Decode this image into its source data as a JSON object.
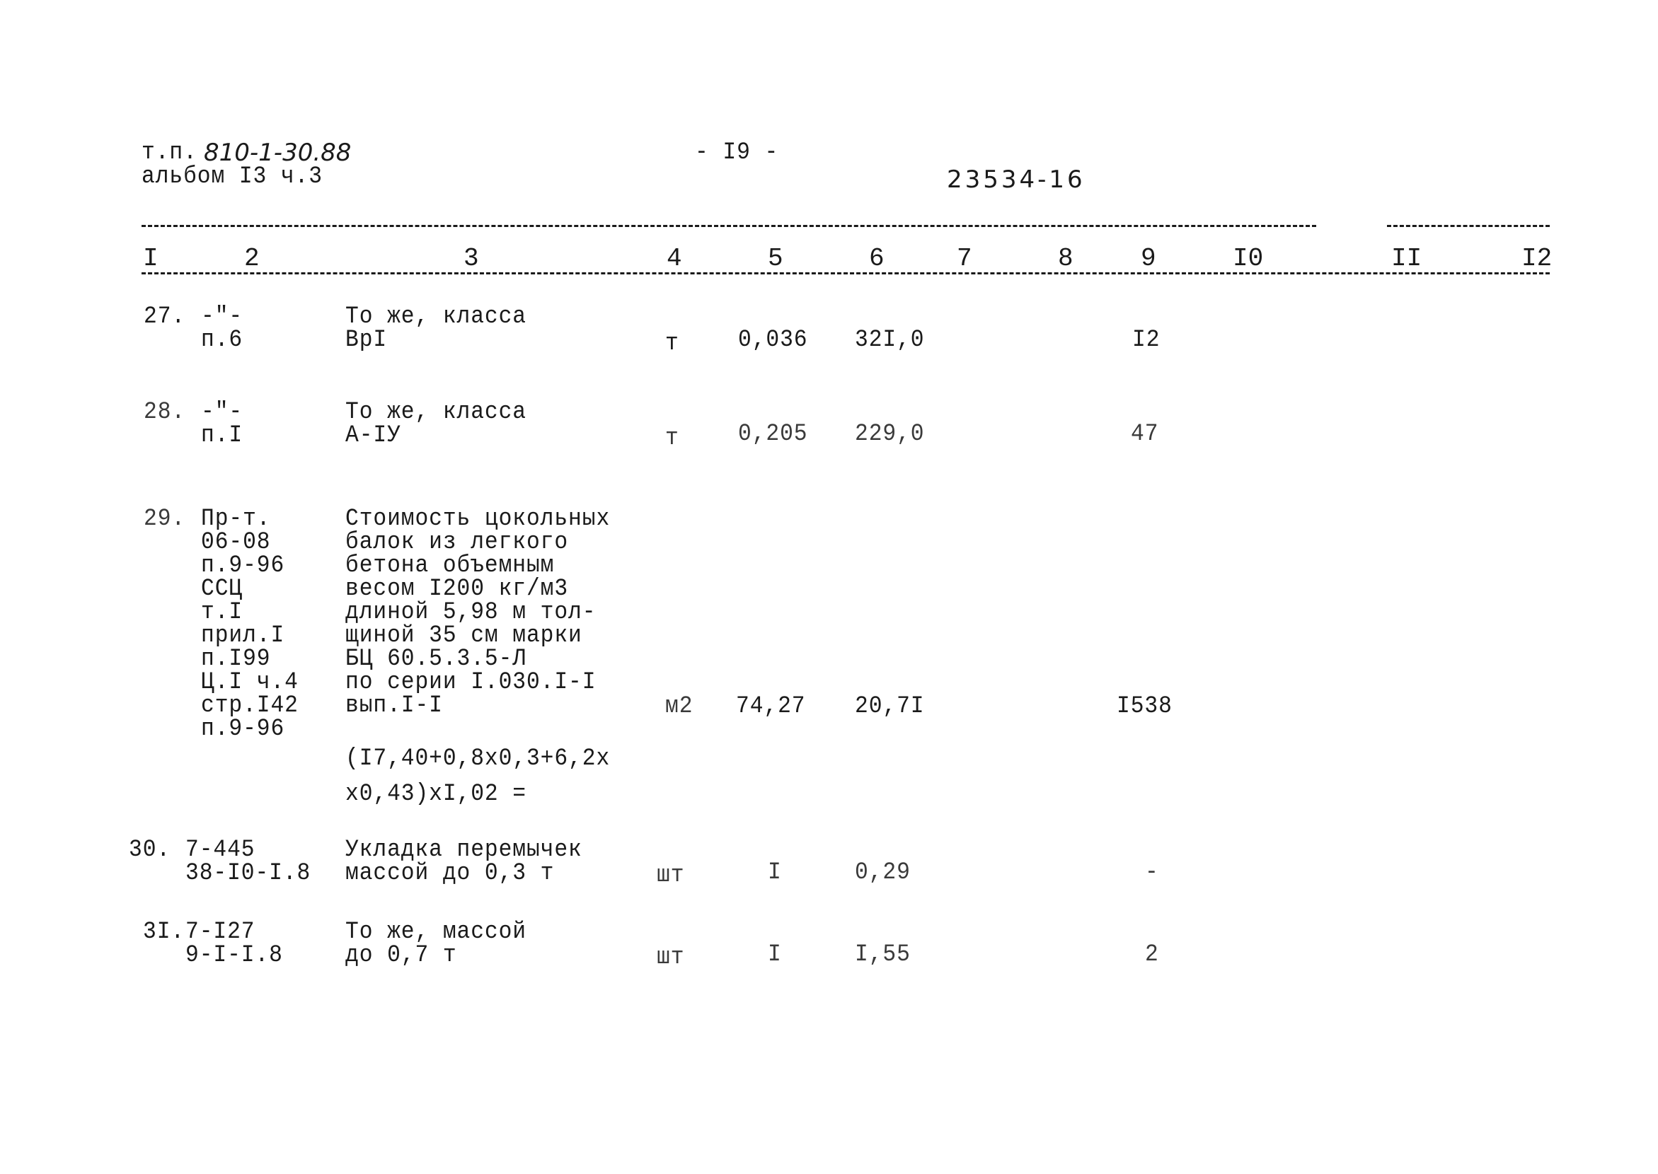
{
  "header": {
    "project_prefix": "т.п.",
    "project_code": "810-1-30.88",
    "album": "альбом I3 ч.3",
    "page_number": "- I9 -",
    "inventory_number": "23534-16"
  },
  "table": {
    "column_numbers": [
      "I",
      "2",
      "3",
      "4",
      "5",
      "6",
      "7",
      "8",
      "9",
      "I0",
      "II",
      "I2"
    ],
    "rows": [
      {
        "num": "27.",
        "ref": [
          "-\"-",
          "п.6"
        ],
        "description": [
          "То же, класса",
          "ВрI"
        ],
        "unit": "т",
        "quantity": "0,036",
        "unit_price": "32I,0",
        "total": "I2"
      },
      {
        "num": "28.",
        "ref": [
          "-\"-",
          "п.I"
        ],
        "description": [
          "То же, класса",
          "А-IУ"
        ],
        "unit": "т",
        "quantity": "0,205",
        "unit_price": "229,0",
        "total": "47"
      },
      {
        "num": "29.",
        "ref": [
          "Пр-т.",
          "06-08",
          "п.9-96",
          "ССЦ",
          "т.I",
          "прил.I",
          "п.I99",
          "Ц.I ч.4",
          "стр.I42",
          "п.9-96"
        ],
        "description": [
          "Стоимость цокольных",
          "балок из легкого",
          "бетона объемным",
          "весом I200 кг/м3",
          "длиной 5,98 м тол-",
          "щиной 35 см марки",
          "БЦ 60.5.3.5-Л",
          "по серии I.030.I-I",
          "вып.I-I"
        ],
        "formula": [
          "(I7,40+0,8x0,3+6,2x",
          "x0,43)xI,02 ="
        ],
        "unit": "м2",
        "quantity": "74,27",
        "unit_price": "20,7I",
        "total": "I538"
      },
      {
        "num": "30.",
        "ref": [
          "7-445",
          "38-I0-I.8"
        ],
        "description": [
          "Укладка перемычек",
          "массой до 0,3 т"
        ],
        "unit": "шт",
        "quantity": "I",
        "unit_price": "0,29",
        "total": "-"
      },
      {
        "num": "3I.",
        "ref": [
          "7-I27",
          "9-I-I.8"
        ],
        "description": [
          "То же, массой",
          "до 0,7 т"
        ],
        "unit": "шт",
        "quantity": "I",
        "unit_price": "I,55",
        "total": "2"
      }
    ]
  }
}
